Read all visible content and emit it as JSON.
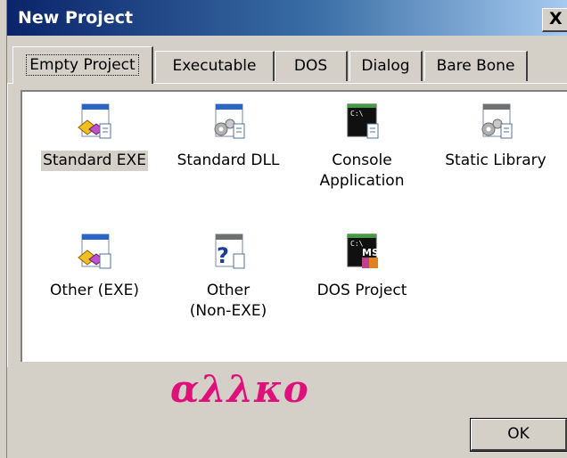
{
  "window": {
    "title": "New Project",
    "close_label": "X"
  },
  "tabs": [
    {
      "label": "Empty Project",
      "active": true
    },
    {
      "label": "Executable",
      "active": false
    },
    {
      "label": "DOS",
      "active": false
    },
    {
      "label": "Dialog",
      "active": false
    },
    {
      "label": "Bare Bone",
      "active": false
    }
  ],
  "projects": [
    {
      "label": "Standard EXE",
      "icon": "standard-exe-icon",
      "selected": true
    },
    {
      "label": "Standard DLL",
      "icon": "standard-dll-icon",
      "selected": false
    },
    {
      "label": "Console\nApplication",
      "icon": "console-app-icon",
      "selected": false
    },
    {
      "label": "Static Library",
      "icon": "static-library-icon",
      "selected": false
    },
    {
      "label": "Other (EXE)",
      "icon": "other-exe-icon",
      "selected": false
    },
    {
      "label": "Other\n(Non-EXE)",
      "icon": "other-non-exe-icon",
      "selected": false
    },
    {
      "label": "DOS Project",
      "icon": "dos-project-icon",
      "selected": false
    }
  ],
  "watermark": "αλλκο",
  "buttons": {
    "ok": "OK"
  },
  "colors": {
    "title_start": "#0a246a",
    "title_end": "#a6caf0",
    "watermark": "#e0107a",
    "face": "#d4d0c8"
  }
}
